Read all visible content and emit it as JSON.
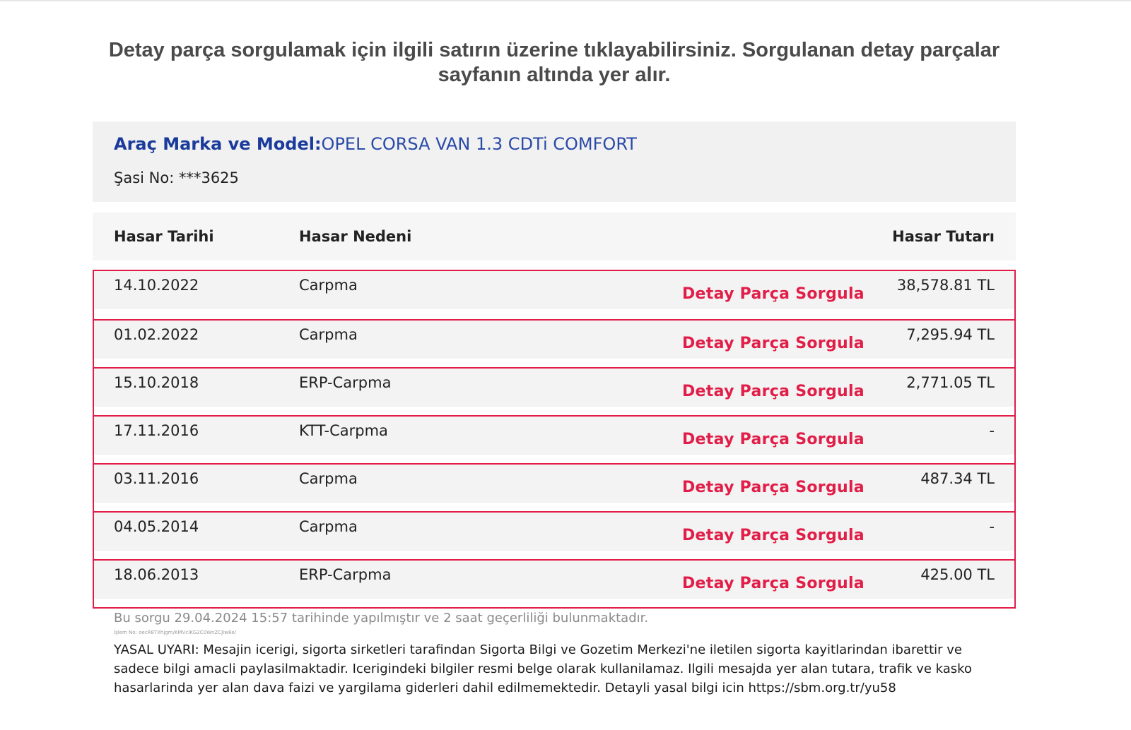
{
  "instruction": "Detay parça sorgulamak için ilgili satırın üzerine tıklayabilirsiniz. Sorgulanan detay parçalar sayfanın altında yer alır.",
  "vehicle": {
    "label": "Araç Marka ve Model:",
    "model": "OPEL CORSA VAN 1.3 CDTi COMFORT",
    "chassis": "Şasi No: ***3625"
  },
  "table": {
    "headers": {
      "date": "Hasar Tarihi",
      "reason": "Hasar Nedeni",
      "amount": "Hasar Tutarı"
    },
    "detail_label": "Detay Parça Sorgula",
    "rows": [
      {
        "date": "14.10.2022",
        "reason": "Carpma",
        "amount": "38,578.81 TL"
      },
      {
        "date": "01.02.2022",
        "reason": "Carpma",
        "amount": "7,295.94 TL"
      },
      {
        "date": "15.10.2018",
        "reason": "ERP-Carpma",
        "amount": "2,771.05 TL"
      },
      {
        "date": "17.11.2016",
        "reason": "KTT-Carpma",
        "amount": "-"
      },
      {
        "date": "03.11.2016",
        "reason": "Carpma",
        "amount": "487.34 TL"
      },
      {
        "date": "04.05.2014",
        "reason": "Carpma",
        "amount": "-"
      },
      {
        "date": "18.06.2013",
        "reason": "ERP-Carpma",
        "amount": "425.00 TL"
      }
    ]
  },
  "footer": {
    "query_note": "Bu sorgu 29.04.2024 15:57 tarihinde yapılmıştır ve 2 saat geçerliliği bulunmaktadır.",
    "trx_note": "İşlem No: oecR8TXhjgm/KMVcIKG2C0WnZCJIw8e/",
    "legal": "YASAL UYARI: Mesajin icerigi, sigorta sirketleri tarafindan Sigorta Bilgi ve Gozetim Merkezi'ne iletilen sigorta kayitlarindan ibarettir ve sadece bilgi amacli paylasilmaktadir. Icerigindeki bilgiler resmi belge olarak kullanilamaz. Ilgili mesajda yer alan tutara, trafik ve kasko hasarlarinda yer alan dava faizi ve yargilama giderleri dahil edilmemektedir. Detayli yasal bilgi icin https://sbm.org.tr/yu58"
  },
  "colors": {
    "accent_red": "#e11d48",
    "brand_blue": "#1a3a9c"
  }
}
